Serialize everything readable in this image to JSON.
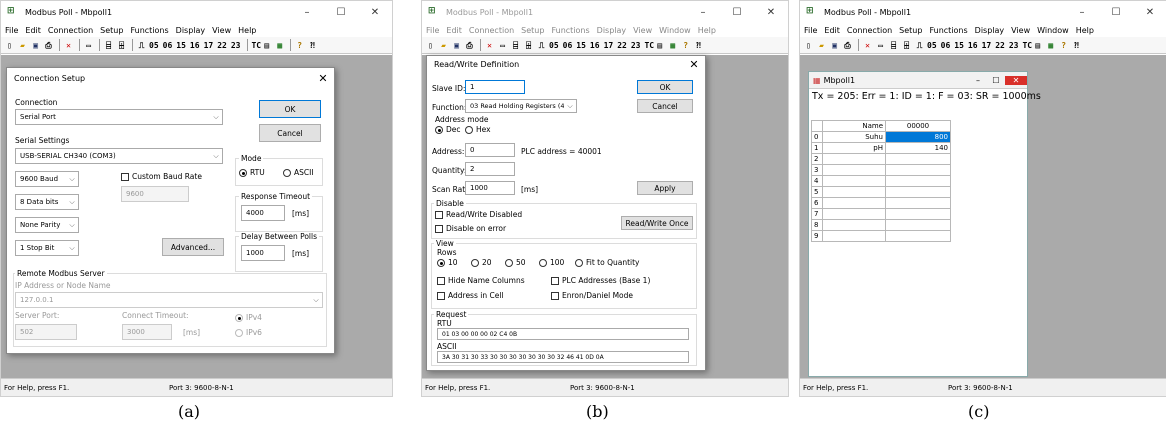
{
  "app": {
    "title": "Modbus Poll - Mbpoll1",
    "menu": [
      "File",
      "Edit",
      "Connection",
      "Setup",
      "Functions",
      "Display",
      "View",
      "Window",
      "Help"
    ],
    "function_codes": [
      "05",
      "06",
      "15",
      "16",
      "17",
      "22",
      "23"
    ],
    "tc_label": "TC",
    "status_help": "For Help, press F1.",
    "status_port": "Port 3: 9600-8-N-1"
  },
  "captions": [
    "(a)",
    "(b)",
    "(c)"
  ],
  "connection_setup": {
    "title": "Connection Setup",
    "connection_label": "Connection",
    "connection_value": "Serial Port",
    "ok": "OK",
    "cancel": "Cancel",
    "serial_settings_label": "Serial Settings",
    "port_value": "USB-SERIAL CH340 (COM3)",
    "baud_value": "9600 Baud",
    "custom_baud_label": "Custom Baud Rate",
    "custom_baud_value": "9600",
    "data_bits_value": "8 Data bits",
    "parity_value": "None Parity",
    "stop_bit_value": "1 Stop Bit",
    "advanced": "Advanced...",
    "mode_label": "Mode",
    "mode_rtu": "RTU",
    "mode_ascii": "ASCII",
    "response_timeout_label": "Response Timeout",
    "response_timeout_value": "4000",
    "ms": "[ms]",
    "delay_label": "Delay Between Polls",
    "delay_value": "1000",
    "remote_label": "Remote Modbus Server",
    "ip_label": "IP Address or Node Name",
    "ip_value": "127.0.0.1",
    "server_port_label": "Server Port:",
    "server_port_value": "502",
    "connect_timeout_label": "Connect Timeout:",
    "connect_timeout_value": "3000",
    "ipv4": "IPv4",
    "ipv6": "IPv6"
  },
  "read_write": {
    "title": "Read/Write Definition",
    "slave_id_label": "Slave ID:",
    "slave_id_value": "1",
    "ok": "OK",
    "cancel": "Cancel",
    "function_label": "Function:",
    "function_value": "03 Read Holding Registers (4x)",
    "address_mode_label": "Address mode",
    "dec": "Dec",
    "hex": "Hex",
    "address_label": "Address:",
    "address_value": "0",
    "plc_address": "PLC address = 40001",
    "quantity_label": "Quantity:",
    "quantity_value": "2",
    "scan_rate_label": "Scan Rate:",
    "scan_rate_value": "1000",
    "ms": "[ms]",
    "apply": "Apply",
    "disable_label": "Disable",
    "rw_disabled": "Read/Write Disabled",
    "disable_on_error": "Disable on error",
    "rw_once": "Read/Write Once",
    "view_label": "View",
    "rows_label": "Rows",
    "rows": [
      "10",
      "20",
      "50",
      "100",
      "Fit to Quantity"
    ],
    "hide_name_columns": "Hide Name Columns",
    "plc_base": "PLC Addresses (Base 1)",
    "address_in_cell": "Address in Cell",
    "enron": "Enron/Daniel Mode",
    "request_label": "Request",
    "rtu_label": "RTU",
    "rtu_value": "01 03 00 00 00 02 C4 0B",
    "ascii_label": "ASCII",
    "ascii_value": "3A 30 31 30 33 30 30 30 30 30 30 30 32 46 41 0D 0A"
  },
  "poll_window": {
    "title": "Mbpoll1",
    "summary": "Tx = 205: Err = 1: ID = 1: F = 03: SR = 1000ms",
    "header_name": "Name",
    "header_value": "00000",
    "rows": [
      {
        "idx": "0",
        "name": "Suhu",
        "value": "800"
      },
      {
        "idx": "1",
        "name": "pH",
        "value": "140"
      },
      {
        "idx": "2",
        "name": "",
        "value": ""
      },
      {
        "idx": "3",
        "name": "",
        "value": ""
      },
      {
        "idx": "4",
        "name": "",
        "value": ""
      },
      {
        "idx": "5",
        "name": "",
        "value": ""
      },
      {
        "idx": "6",
        "name": "",
        "value": ""
      },
      {
        "idx": "7",
        "name": "",
        "value": ""
      },
      {
        "idx": "8",
        "name": "",
        "value": ""
      },
      {
        "idx": "9",
        "name": "",
        "value": ""
      }
    ]
  }
}
